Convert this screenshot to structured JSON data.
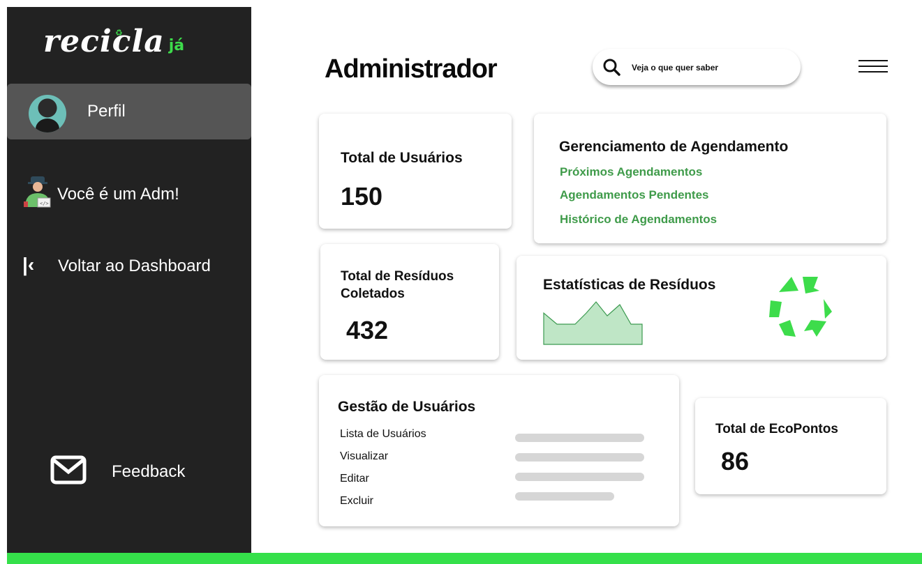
{
  "brand": {
    "name": "recicla",
    "suffix": "já",
    "accent": "#3ddc4b"
  },
  "sidebar": {
    "items": [
      {
        "label": "Perfil",
        "icon": "avatar"
      },
      {
        "label": "Você é um Adm!",
        "icon": "admin-person-icon"
      },
      {
        "label": "Voltar ao Dashboard",
        "icon": "chevron-left-bar-icon"
      },
      {
        "label": "Feedback",
        "icon": "mail-icon"
      }
    ]
  },
  "header": {
    "title": "Administrador",
    "search_placeholder": "Veja o que quer saber"
  },
  "cards": {
    "total_users": {
      "title": "Total de Usuários",
      "value": "150"
    },
    "scheduling": {
      "title": "Gerenciamento de Agendamento",
      "links": [
        "Próximos Agendamentos",
        "Agendamentos Pendentes",
        "Histórico de Agendamentos"
      ]
    },
    "waste_collected": {
      "title_line1": "Total de Resíduos",
      "title_line2": "Coletados",
      "value": "432"
    },
    "waste_stats": {
      "title": "Estatísticas de Resíduos"
    },
    "user_management": {
      "title": "Gestão de Usuários",
      "items": [
        "Lista de Usuários",
        "Visualizar",
        "Editar",
        "Excluir"
      ]
    },
    "ecopoints": {
      "title": "Total de EcoPontos",
      "value": "86"
    }
  },
  "colors": {
    "sidebar_bg": "#222222",
    "active_item_bg": "#555555",
    "link_green": "#3f9b4a",
    "footer_green": "#35e04a",
    "chart_fill": "#bfe6c6",
    "chart_stroke": "#3c9a50"
  }
}
